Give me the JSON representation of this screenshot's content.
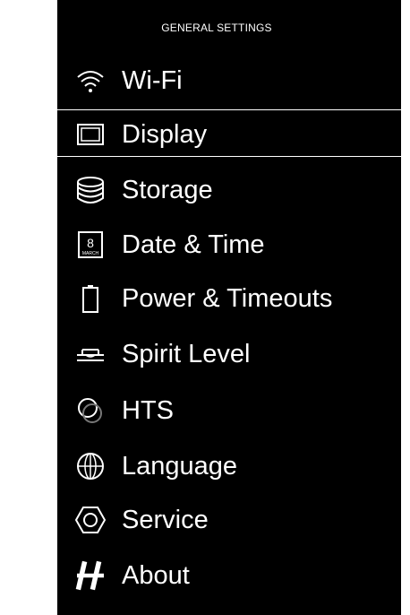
{
  "header": {
    "title": "GENERAL SETTINGS"
  },
  "menu": {
    "selected": "Display",
    "items": [
      {
        "label": "Wi-Fi",
        "icon": "wifi-icon"
      },
      {
        "label": "Display",
        "icon": "display-icon"
      },
      {
        "label": "Storage",
        "icon": "storage-icon"
      },
      {
        "label": "Date & Time",
        "icon": "calendar-icon",
        "icon_text": {
          "day": "8",
          "month": "MARCH"
        }
      },
      {
        "label": "Power & Timeouts",
        "icon": "battery-icon"
      },
      {
        "label": "Spirit Level",
        "icon": "spirit-level-icon"
      },
      {
        "label": "HTS",
        "icon": "hts-icon"
      },
      {
        "label": "Language",
        "icon": "globe-icon"
      },
      {
        "label": "Service",
        "icon": "hexagon-nut-icon"
      },
      {
        "label": "About",
        "icon": "hasselblad-logo-icon"
      }
    ]
  },
  "colors": {
    "background": "#000000",
    "text": "#ffffff",
    "page": "#ffffff"
  }
}
